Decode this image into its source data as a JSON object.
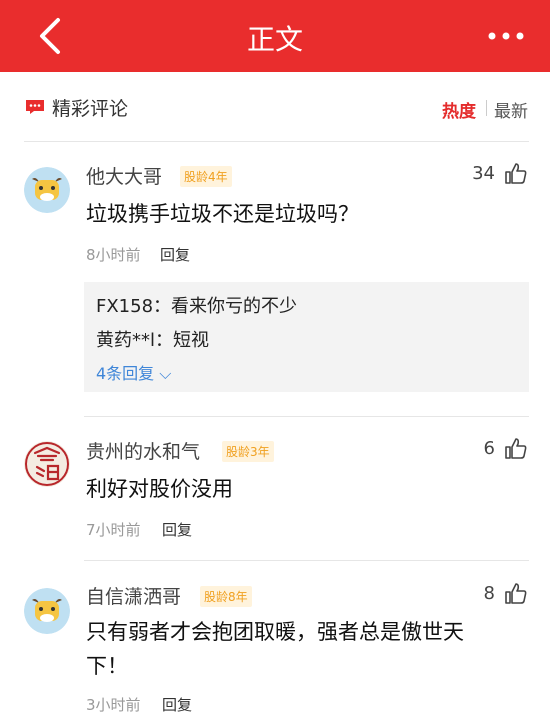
{
  "header": {
    "title": "正文"
  },
  "section": {
    "title": "精彩评论",
    "sort_hot": "热度",
    "sort_new": "最新"
  },
  "comments": [
    {
      "user": "他大大哥",
      "badge": "股龄4年",
      "likes": "34",
      "text": "垃圾携手垃圾不还是垃圾吗？",
      "time": "8小时前",
      "reply": "回复",
      "sub_replies": [
        {
          "user": "FX158：",
          "text": "看来你亏的不少"
        },
        {
          "user": "黄药**l：",
          "text": "短视"
        }
      ],
      "more_replies": "4条回复 ⌵"
    },
    {
      "user": "贵州的水和气",
      "badge": "股龄3年",
      "likes": "6",
      "text": "利好对股价没用",
      "time": "7小时前",
      "reply": "回复"
    },
    {
      "user": "自信潇洒哥",
      "badge": "股龄8年",
      "likes": "8",
      "text_line1": "只有弱者才会抱团取暖，强者总是傲世天",
      "text_line2": "下！",
      "time": "3小时前",
      "reply": "回复"
    }
  ],
  "colors": {
    "brand_red": "#e92d2d",
    "badge_orange": "#f0a020",
    "link_blue": "#3f86d8"
  }
}
